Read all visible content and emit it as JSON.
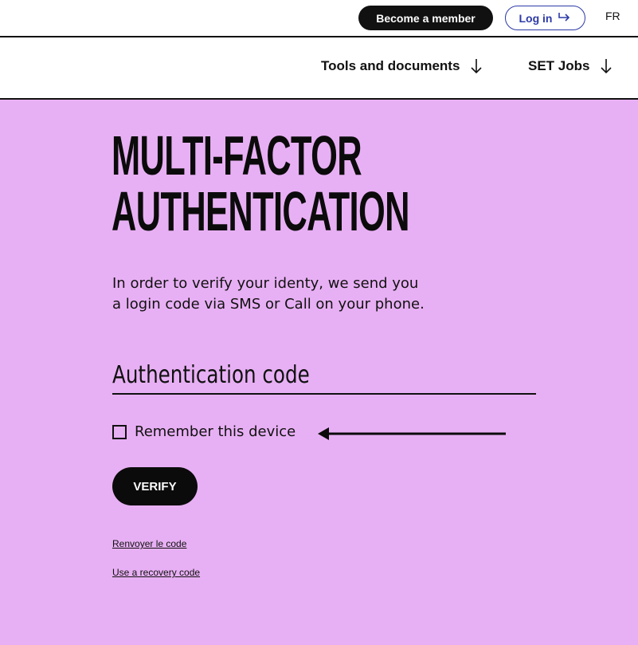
{
  "header": {
    "become_member": "Become a member",
    "login": "Log in",
    "login_icon": "login-arrow-icon",
    "language": "FR"
  },
  "nav": {
    "items": [
      {
        "label": "Tools and documents",
        "icon": "arrow-down-icon"
      },
      {
        "label": "SET Jobs",
        "icon": "arrow-down-icon"
      }
    ]
  },
  "main": {
    "title_line1": "MULTI-FACTOR",
    "title_line2": "AUTHENTICATION",
    "intro": "In order to verify your identy, we send you a login code via SMS or Call on your phone.",
    "code_placeholder": "Authentication code",
    "code_value": "",
    "remember_label": "Remember this device",
    "remember_checked": false,
    "verify_label": "VERIFY",
    "resend_link": "Renvoyer le code",
    "recovery_link": "Use a recovery code"
  },
  "colors": {
    "background": "#e8b0f4",
    "login_accent": "#2d3aa7",
    "dark": "#0b0b0b"
  }
}
